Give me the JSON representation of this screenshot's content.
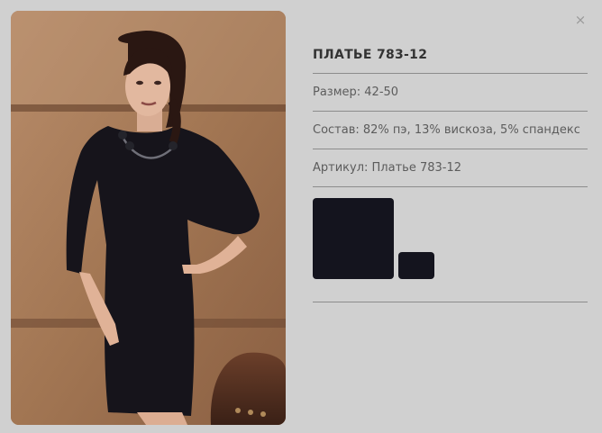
{
  "product": {
    "title": "ПЛАТЬЕ 783-12",
    "size": "Размер: 42-50",
    "composition": "Состав: 82% пэ, 13% вискоза, 5% спандекс",
    "article": "Артикул: Платье 783-12"
  },
  "close_label": "×",
  "swatch_color": "#14141e",
  "icons": [
    "close-icon"
  ]
}
